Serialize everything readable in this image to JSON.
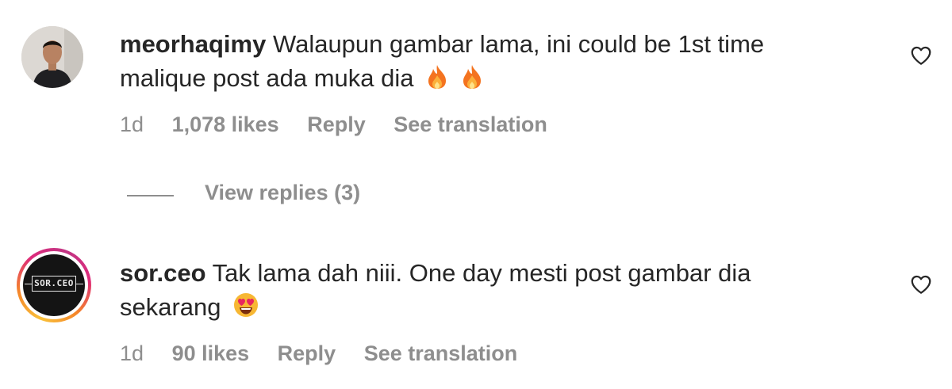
{
  "comments": [
    {
      "username": "meorhaqimy",
      "text_line1": "Walaupun gambar lama, ini could be 1st time",
      "text_line2": "malique post ada muka dia",
      "emojis": [
        "fire",
        "fire"
      ],
      "time": "1d",
      "likes": "1,078 likes",
      "reply_label": "Reply",
      "translate_label": "See translation",
      "view_replies_label": "View replies (3)"
    },
    {
      "username": "sor.ceo",
      "avatar_text": "SOR.CEO",
      "text_line1": "Tak lama dah niii. One day mesti post gambar dia",
      "text_line2": "sekarang",
      "emojis": [
        "heart-eyes"
      ],
      "time": "1d",
      "likes": "90 likes",
      "reply_label": "Reply",
      "translate_label": "See translation"
    }
  ],
  "icons": {
    "like": "heart-outline-icon",
    "avatar_story_ring": "gradient-ring"
  },
  "colors": {
    "text": "#262626",
    "muted": "#8e8e8e",
    "ring_start": "#f9c13a",
    "ring_mid": "#dd2a7b"
  }
}
